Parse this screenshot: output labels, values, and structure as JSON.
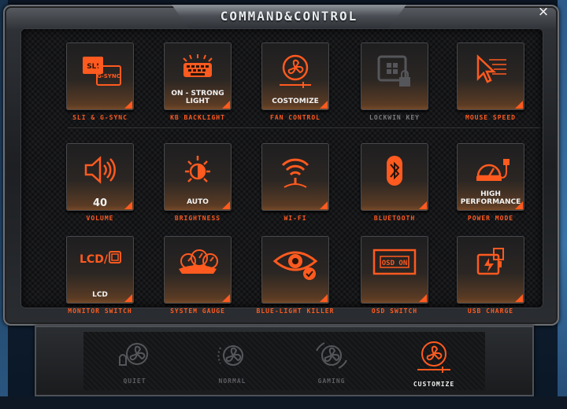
{
  "window": {
    "title": "COMMAND&CONTROL",
    "close_label": "×"
  },
  "tiles": [
    {
      "label": "SLI & G-SYNC",
      "value": "",
      "icon": "sli-gsync-icon",
      "active": true
    },
    {
      "label": "KB BACKLIGHT",
      "value": "ON - STRONG LIGHT",
      "icon": "keyboard-backlight-icon",
      "active": true
    },
    {
      "label": "FAN CONTROL",
      "value": "COSTOMIZE",
      "icon": "fan-icon",
      "active": true
    },
    {
      "label": "LOCKWIN KEY",
      "value": "",
      "icon": "lock-windows-key-icon",
      "active": false
    },
    {
      "label": "MOUSE SPEED",
      "value": "",
      "icon": "mouse-pointer-icon",
      "active": true
    },
    {
      "label": "VOLUME",
      "value": "40",
      "icon": "speaker-icon",
      "active": true
    },
    {
      "label": "BRIGHTNESS",
      "value": "AUTO",
      "icon": "sun-icon",
      "active": true
    },
    {
      "label": "WI-FI",
      "value": "",
      "icon": "wifi-icon",
      "active": true
    },
    {
      "label": "BLUETOOTH",
      "value": "",
      "icon": "bluetooth-icon",
      "active": true
    },
    {
      "label": "POWER MODE",
      "value": "HIGH PERFORMANCE",
      "icon": "power-plug-gauge-icon",
      "active": true
    },
    {
      "label": "MONITOR SWITCH",
      "value": "LCD",
      "icon": "lcd-monitor-icon",
      "active": true
    },
    {
      "label": "SYSTEM GAUGE",
      "value": "",
      "icon": "gauges-icon",
      "active": true
    },
    {
      "label": "BLUE-LIGHT KILLER",
      "value": "",
      "icon": "eye-check-icon",
      "active": true
    },
    {
      "label": "OSD SWITCH",
      "value": "",
      "icon": "osd-screen-icon",
      "active": true
    },
    {
      "label": "USB CHARGE",
      "value": "",
      "icon": "usb-battery-icon",
      "active": true
    }
  ],
  "icon_text": {
    "sli": "SLI",
    "gsync": "G-SYNC",
    "lcd": "LCD/",
    "osd": "OSD ON"
  },
  "fan_modes": [
    {
      "label": "QUIET",
      "active": false
    },
    {
      "label": "NORMAL",
      "active": false
    },
    {
      "label": "GAMING",
      "active": false
    },
    {
      "label": "CUSTOMIZE",
      "active": true
    }
  ],
  "colors": {
    "accent": "#ff5a1f",
    "inactive_label": "#7b7b7e",
    "tile_glow": "#7a4c28"
  }
}
